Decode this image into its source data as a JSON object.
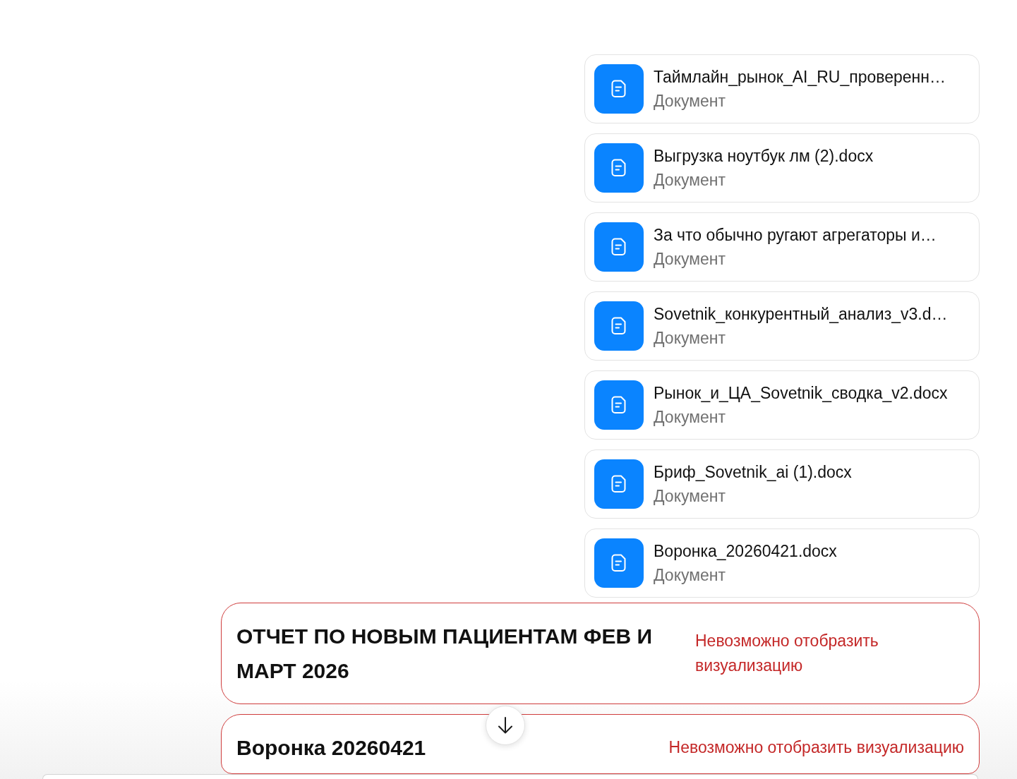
{
  "attachments": [
    {
      "name": "Таймлайн_рынок_AI_RU_проверенн…",
      "type": "Документ"
    },
    {
      "name": "Выгрузка ноутбук лм (2).docx",
      "type": "Документ"
    },
    {
      "name": "За что обычно ругают агрегаторы и…",
      "type": "Документ"
    },
    {
      "name": "Sovetnik_конкурентный_анализ_v3.d…",
      "type": "Документ"
    },
    {
      "name": "Рынок_и_ЦА_Sovetnik_сводка_v2.docx",
      "type": "Документ"
    },
    {
      "name": "Бриф_Sovetnik_ai (1).docx",
      "type": "Документ"
    },
    {
      "name": "Воронка_20260421.docx",
      "type": "Документ"
    }
  ],
  "visualizations": [
    {
      "title": "ОТЧЕТ ПО НОВЫМ ПАЦИЕНТАМ ФЕВ И МАРТ 2026",
      "error": "Невозможно отобразить визуализацию"
    },
    {
      "title": "Воронка 20260421",
      "error": "Невозможно отобразить визуализацию"
    }
  ]
}
